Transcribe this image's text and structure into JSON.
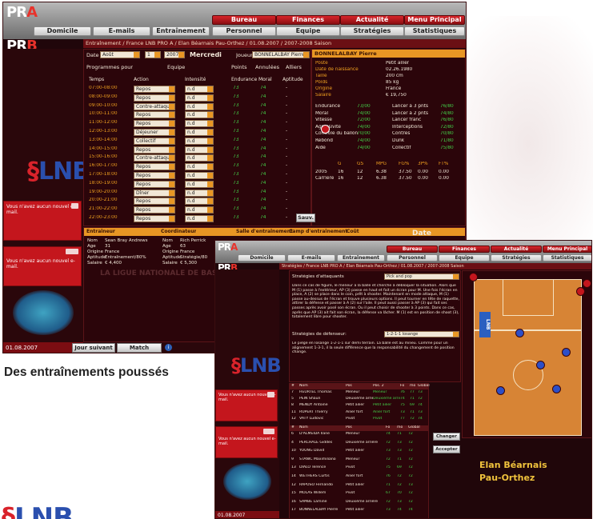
{
  "caption": "Des entraînements poussés",
  "game_logo": {
    "line1": "PR",
    "line1_accent": "A",
    "line2": "PR",
    "line2_accent": "B"
  },
  "nav_top": [
    "Bureau",
    "Finances",
    "Actualité",
    "Menu Principal"
  ],
  "nav_bottom": [
    "Domicile",
    "E-mails",
    "Entraînement",
    "Personnel",
    "Equipe",
    "Stratégies",
    "Statistiques"
  ],
  "shot1": {
    "breadcrumb": "Entraînement / France LNB PRO A / Elan Béarnais Pau-Orthez / 01.08.2007 / 2007-2008 Saison",
    "date_label": "Date",
    "date_month": "Août",
    "date_day": "1",
    "date_year": "2007",
    "date_weekday": "Mercredi",
    "joueur_label": "Joueur",
    "joueur_value": "BONNELALBAY Pierre",
    "programmes_label": "Programmes pour",
    "programmes_value": "Equipe",
    "options": [
      "Points",
      "Annulées",
      "Alliers"
    ],
    "table_headers": [
      "Temps",
      "Action",
      "Intensité",
      "Endurance",
      "Moral",
      "Aptitude"
    ],
    "schedule": [
      {
        "time": "07:00-08:00",
        "action": "Repos",
        "intensity": "n.d",
        "end": "73",
        "moral": "74",
        "apt": "-"
      },
      {
        "time": "08:00-09:00",
        "action": "Repos",
        "intensity": "n.d",
        "end": "73",
        "moral": "74",
        "apt": "-"
      },
      {
        "time": "09:00-10:00",
        "action": "Contre-attaque",
        "intensity": "n.d",
        "end": "73",
        "moral": "74",
        "apt": "-"
      },
      {
        "time": "10:00-11:00",
        "action": "Repos",
        "intensity": "n.d",
        "end": "73",
        "moral": "74",
        "apt": "-"
      },
      {
        "time": "11:00-12:00",
        "action": "Repos",
        "intensity": "n.d",
        "end": "73",
        "moral": "74",
        "apt": "-"
      },
      {
        "time": "12:00-13:00",
        "action": "Déjeuner",
        "intensity": "n.d",
        "end": "73",
        "moral": "74",
        "apt": "-"
      },
      {
        "time": "13:00-14:00",
        "action": "Collectif",
        "intensity": "n.d",
        "end": "73",
        "moral": "74",
        "apt": "-"
      },
      {
        "time": "14:00-15:00",
        "action": "Repos",
        "intensity": "n.d",
        "end": "73",
        "moral": "74",
        "apt": "-"
      },
      {
        "time": "15:00-16:00",
        "action": "Contre-attaque",
        "intensity": "n.d",
        "end": "73",
        "moral": "74",
        "apt": "-"
      },
      {
        "time": "16:00-17:00",
        "action": "Repos",
        "intensity": "n.d",
        "end": "73",
        "moral": "74",
        "apt": "-"
      },
      {
        "time": "17:00-18:00",
        "action": "Repos",
        "intensity": "n.d",
        "end": "73",
        "moral": "74",
        "apt": "-"
      },
      {
        "time": "18:00-19:00",
        "action": "Repos",
        "intensity": "n.d",
        "end": "73",
        "moral": "74",
        "apt": "-"
      },
      {
        "time": "19:00-20:00",
        "action": "Dîner",
        "intensity": "n.d",
        "end": "73",
        "moral": "74",
        "apt": "-"
      },
      {
        "time": "20:00-21:00",
        "action": "Repos",
        "intensity": "n.d",
        "end": "73",
        "moral": "74",
        "apt": "-"
      },
      {
        "time": "21:00-22:00",
        "action": "Repos",
        "intensity": "n.d",
        "end": "73",
        "moral": "74",
        "apt": "-"
      },
      {
        "time": "22:00-23:00",
        "action": "Repos",
        "intensity": "n.d",
        "end": "73",
        "moral": "74",
        "apt": "-"
      }
    ],
    "player_name": "BONNELALBAY Pierre",
    "player_info": [
      [
        "Poste",
        "Petit ailier"
      ],
      [
        "Date de naissance",
        "02.26.1980"
      ],
      [
        "Taille",
        "200 cm"
      ],
      [
        "Poids",
        "85 kg"
      ],
      [
        "Origine",
        "France"
      ],
      [
        "Salaire",
        "€ 19,750"
      ]
    ],
    "skills": [
      [
        "Endurance",
        "73/00",
        "Lancer à 3 pnts",
        "76/80"
      ],
      [
        "Moral",
        "74/00",
        "Lancer à 2 pnts",
        "74/80"
      ],
      [
        "Vitesse",
        "72/00",
        "Lancer franc",
        "76/80"
      ],
      [
        "Agressivité",
        "74/00",
        "Interceptions",
        "72/80"
      ],
      [
        "Contrôle du ballon",
        "70/00",
        "Contres",
        "70/80"
      ],
      [
        "Rebond",
        "74/00",
        "Dunk",
        "71/80"
      ],
      [
        "Aide",
        "74/00",
        "Collectif",
        "75/80"
      ]
    ],
    "stats_headers": [
      "",
      "G",
      "GS",
      "MPG",
      "FG%",
      "3P%",
      "FT%"
    ],
    "stats_rows": [
      [
        "2005",
        "16",
        "12",
        "6.38",
        "37.50",
        "0.00",
        "0.00"
      ],
      [
        "Carrière",
        "16",
        "12",
        "6.38",
        "37.50",
        "0.00",
        "0.00"
      ]
    ],
    "save_label": "Sauv.",
    "bottom_tabs": [
      "Entraîneur",
      "Coordinateur",
      "Salle d'entraînement",
      "Camp d'entraînement",
      "Coût",
      "Date"
    ],
    "coach1": [
      [
        "Nom",
        "Sean Bray Andrews"
      ],
      [
        "Âge",
        "31"
      ],
      [
        "Origine",
        "France"
      ],
      [
        "Aptitude",
        "Entraînement/80%"
      ],
      [
        "Salaire",
        "€ 4,400"
      ]
    ],
    "coach2": [
      [
        "Nom",
        "Rich Perrick"
      ],
      [
        "Âge",
        "63"
      ],
      [
        "Origine",
        "France"
      ],
      [
        "Aptitude",
        "Stratégie/80"
      ],
      [
        "Salaire",
        "€ 5,300"
      ]
    ],
    "watermark": "LA LIGUE NATIONALE DE BASKET",
    "msg_text": "Vous n'avez aucun nouvel e-mail.",
    "status_date": "01.08.2007",
    "btn_next_day": "Jour suivant",
    "btn_next_match": "Match suivant"
  },
  "shot2": {
    "breadcrumb": "Stratégies / France LNB PRO A / Elan Béarnais Pau-Orthez / 01.08.2007 / 2007-2008 Saison",
    "attack_label": "Stratégies d'attaquants",
    "attack_value": "Pick and pop",
    "attack_text": "Dans ce cas de figure, le meneur a la balle et cherche à débloquer la situation. Alors que M (1) passe à l'extérieur, AP (3) passe en haut et fait un écran pour M. Une fois l'écran en place, A (2) se place dans le coin, prêt à shooter. Maintenant en mode attaque, M (1) passe au-dessus de l'écran et trouve plusieurs options. Il peut tourner en tête de raquette, attirer la défense et passer à A (2) sur l'aile. Il peut aussi passer à AP (3) qui fait ses passes après avoir posé son écran. Ou il peut choisir de shooter à 3 points. Dans ce cas, après que AP (3) ait fait son écran, la défense va lâcher. M (1) est en position de shoot (3), totalement libre pour shooter.",
    "defense_label": "Stratégies de défenseur:",
    "defense_value": "1-2-1-1 losange",
    "defense_text": "Le piège en losange 1-2-1-1 sur demi terrain. La balle est au milieu. Comme pour un alignement 1-3-1, il la seule différence que la responsabilité du changement de position change.",
    "roster_headers": [
      "#",
      "Nom",
      "Pos",
      "Pos. 2",
      "Fo",
      "mo",
      "Global"
    ],
    "starters": [
      [
        "7",
        "HEURTEL Thomas",
        "Meneur",
        "Meneur",
        "76",
        "77",
        "73"
      ],
      [
        "5",
        "PEIN Shaun",
        "Deuxième arrière",
        "Deuxième arrière",
        "74",
        "71",
        "72"
      ],
      [
        "8",
        "MENDY Antoine",
        "Petit ailier",
        "Petit ailier",
        "75",
        "69",
        "74"
      ],
      [
        "11",
        "RUPERT Thierry",
        "Ailier fort",
        "Ailier fort",
        "73",
        "71",
        "73"
      ],
      [
        "12",
        "VATY Ludovic",
        "Pivot",
        "Pivot",
        "77",
        "72",
        "74"
      ]
    ],
    "bench_headers": [
      "#",
      "Nom",
      "Pos",
      "Fo",
      "mo",
      "Global"
    ],
    "bench": [
      [
        "6",
        "D'ALMEIDA Ilane",
        "Meneur",
        "74",
        "71",
        "72"
      ],
      [
        "4",
        "PERCHALE Giddes",
        "Deuxième arrière",
        "72",
        "73",
        "72"
      ],
      [
        "10",
        "YOUNG David",
        "Petit ailier",
        "73",
        "73",
        "72"
      ],
      [
        "9",
        "STANIC Maximiliano",
        "Meneur",
        "72",
        "71",
        "72"
      ],
      [
        "13",
        "DIALO Terence",
        "Pivot",
        "75",
        "69",
        "72"
      ],
      [
        "14",
        "WETHERS Curtis",
        "Ailier fort",
        "76",
        "72",
        "72"
      ],
      [
        "12",
        "RAPOSO Fernando",
        "Petit ailier",
        "71",
        "72",
        "73"
      ],
      [
        "15",
        "MOLAS Willem",
        "Pivot",
        "67",
        "70",
        "72"
      ],
      [
        "16",
        "SAMBE Lamine",
        "Deuxième arrière",
        "72",
        "73",
        "72"
      ],
      [
        "17",
        "BONNELALBAY Pierre",
        "Petit ailier",
        "73",
        "74",
        "74"
      ]
    ],
    "btn_change": "Changer",
    "btn_accept": "Accepter",
    "team_name_1": "Elan Béarnais",
    "team_name_2": "Pau-Orthez",
    "msg_text": "Vous n'avez aucun nouvel e-mail.",
    "status_date": "01.08.2007"
  },
  "colors": {
    "accent": "#e89624",
    "brand_red": "#c4161d",
    "green_value": "#44d24a",
    "bg_dark": "#20060a"
  }
}
